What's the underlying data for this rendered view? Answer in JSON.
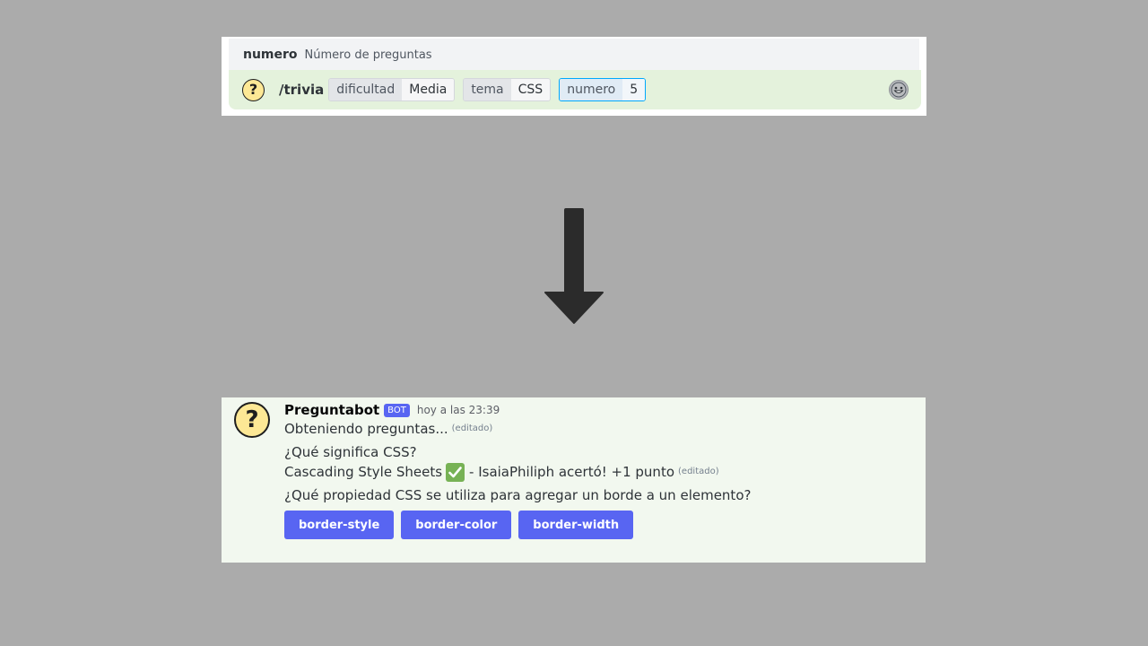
{
  "command_panel": {
    "hint": {
      "option_name": "numero",
      "option_description": "Número de preguntas"
    },
    "app_icon_glyph": "?",
    "command": "/trivia",
    "options": [
      {
        "key": "dificultad",
        "value": "Media"
      },
      {
        "key": "tema",
        "value": "CSS"
      },
      {
        "key": "numero",
        "value": "5"
      }
    ],
    "emoji_button_icon": "smiley-face-icon"
  },
  "arrow_icon": "arrow-down-icon",
  "message": {
    "avatar_glyph": "?",
    "author": "Preguntabot",
    "bot_tag": "BOT",
    "timestamp": "hoy a las 23:39",
    "edited_label": "(editado)",
    "line1": "Obteniendo preguntas...",
    "question1": "¿Qué significa CSS?",
    "answer1": "Cascading Style Sheets",
    "answer1_icon": "check-mark-emoji",
    "answer1_suffix": "- IsaiaPhiliph acertó! +1 punto",
    "question2": "¿Qué propiedad CSS se utiliza para agregar un borde a un elemento?",
    "buttons": [
      {
        "label": "border-style"
      },
      {
        "label": "border-color"
      },
      {
        "label": "border-width"
      }
    ]
  },
  "colors": {
    "background": "#ababab",
    "blurple": "#5865f2",
    "command_bar": "#e4f2dc",
    "message_bg": "#f2f8ef",
    "active_option_border": "#00a8fc",
    "check_green": "#77b255"
  }
}
